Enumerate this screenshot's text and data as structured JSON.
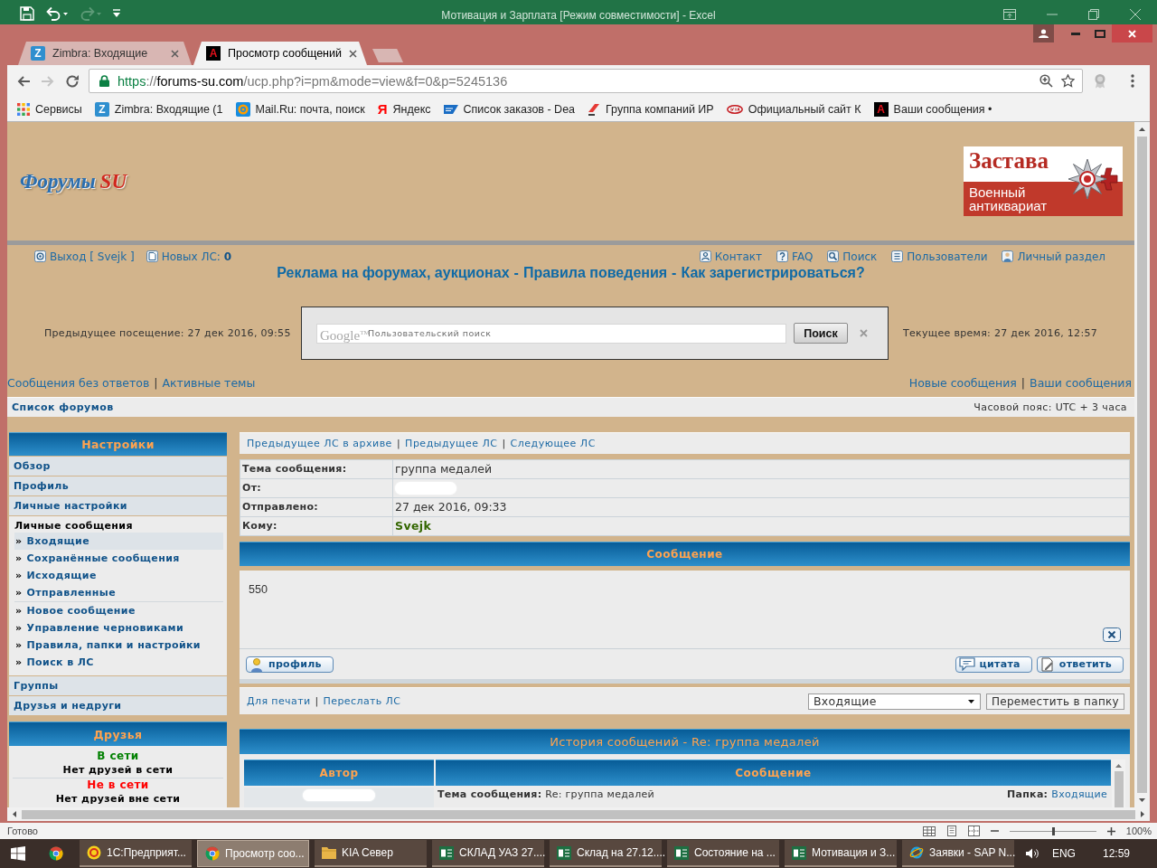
{
  "excel": {
    "title": "Мотивация и Зарплата [Режим совместимости] - Excel",
    "quick_access": [
      {
        "kind": "save",
        "disabled": false
      },
      {
        "kind": "undo",
        "disabled": false
      },
      {
        "kind": "redo",
        "disabled": true
      },
      {
        "kind": "customize",
        "disabled": false
      }
    ],
    "status": "Готово",
    "zoom": {
      "level": 0.5,
      "reading": "100%"
    }
  },
  "browser": {
    "tabs": [
      {
        "kind": "zimbra",
        "glyph": "Z",
        "label": "Zimbra: Входящие",
        "selected": false
      },
      {
        "kind": "forum",
        "glyph": "A",
        "label": "Просмотр сообщений",
        "selected": true
      }
    ],
    "nav": [
      {
        "kind": "back",
        "disabled": false
      },
      {
        "kind": "forward",
        "disabled": true
      },
      {
        "kind": "reload",
        "disabled": false
      }
    ],
    "url": {
      "scheme": "https",
      "separator": "://",
      "host": "forums-su.com",
      "path": "/ucp.php?i=pm&mode=view&f=0&p=5245136"
    },
    "bookmarks": [
      {
        "kind": "apps",
        "label": "Сервисы"
      },
      {
        "kind": "zimbra",
        "glyph": "Z",
        "label": "Zimbra: Входящие (1"
      },
      {
        "kind": "mail",
        "label": "Mail.Ru: почта, поиск"
      },
      {
        "kind": "yandex",
        "glyph": "Я",
        "label": "Яндекс"
      },
      {
        "kind": "sap",
        "label": "Список заказов - Dea"
      },
      {
        "kind": "stripe",
        "label": "Группа компаний ИР"
      },
      {
        "kind": "kia",
        "label": "Официальный сайт К"
      },
      {
        "kind": "forum",
        "glyph": "A",
        "label": "Ваши сообщения •"
      }
    ]
  },
  "forum": {
    "logo": {
      "text": "Форумы",
      "accent": "SU"
    },
    "banner": {
      "title": "Застава",
      "subtitle": "Военный антиквариат"
    },
    "user_links": [
      {
        "kind": "exit",
        "label": "Выход [ Svejk ]"
      },
      {
        "kind": "pm",
        "label": "Новых ЛС: **0**"
      }
    ],
    "nav_links": [
      {
        "kind": "contact",
        "label": "Контакт"
      },
      {
        "kind": "faq",
        "label": "FAQ"
      },
      {
        "kind": "search",
        "label": "Поиск"
      },
      {
        "kind": "users",
        "label": "Пользователи"
      },
      {
        "kind": "profile",
        "label": "Личный раздел"
      }
    ],
    "headline": {
      "links": [
        "Реклама на форумах, аукционах",
        "Правила поведения",
        "Как зарегистрироваться?"
      ],
      "separator": "-"
    },
    "last_visit": "Предыдущее посещение: 27 дек 2016, 09:55",
    "current_time": "Текущее время: 27 дек 2016, 12:57",
    "search": {
      "logo": "Google$^{TM}$",
      "placeholder": "Пользовательский поиск",
      "button": "Поиск"
    },
    "quick_links_left": {
      "links": [
        "Сообщения без ответов",
        "Активные темы"
      ],
      "separator": "|"
    },
    "quick_links_right": {
      "links": [
        "Новые сообщения",
        "Ваши сообщения"
      ],
      "separator": "|"
    },
    "breadcrumb": "Список форумов",
    "timezone": "Часовой пояс: UTC + 3 часа",
    "sidebar": {
      "title": "Настройки",
      "bullet": "»",
      "items": [
        {
          "label": "Обзор",
          "expanded": false
        },
        {
          "label": "Профиль",
          "expanded": false
        },
        {
          "label": "Личные настройки",
          "expanded": false
        },
        {
          "label": "Личные сообщения",
          "expanded": true,
          "children": [
            {
              "label": "Входящие",
              "selected": true,
              "divider": false
            },
            {
              "label": "Сохранённые сообщения",
              "selected": false,
              "divider": false
            },
            {
              "label": "Исходящие",
              "selected": false,
              "divider": false
            },
            {
              "label": "Отправленные",
              "selected": false,
              "divider": false
            },
            {
              "label": "Новое сообщение",
              "selected": false,
              "divider": true
            },
            {
              "label": "Управление черновиками",
              "selected": false,
              "divider": false
            },
            {
              "label": "Правила, папки и настройки",
              "selected": false,
              "divider": false
            },
            {
              "label": "Поиск в ЛС",
              "selected": false,
              "divider": false
            }
          ]
        },
        {
          "label": "Группы",
          "expanded": false
        },
        {
          "label": "Друзья и недруги",
          "expanded": false
        }
      ]
    },
    "friends": {
      "title": "Друзья",
      "groups": [
        {
          "kind": "online",
          "label": "В сети",
          "note": "Нет друзей в сети"
        },
        {
          "kind": "offline",
          "label": "Не в сети",
          "note": "Нет друзей вне сети"
        }
      ]
    },
    "pm_nav": {
      "links": [
        "Предыдущее ЛС в архиве",
        "Предыдущее ЛС",
        "Следующее ЛС"
      ],
      "separator": "|"
    },
    "message": {
      "fields": [
        {
          "kind": "text",
          "label": "Тема сообщения:",
          "value": "группа медалей"
        },
        {
          "kind": "redacted",
          "label": "От:"
        },
        {
          "kind": "text",
          "label": "Отправлено:",
          "value": "27 дек 2016, 09:33"
        },
        {
          "kind": "user",
          "label": "Кому:",
          "value": "Svejk"
        }
      ],
      "title": "Сообщение",
      "body": "550",
      "author_buttons": [
        {
          "kind": "profile",
          "label": "профиль"
        }
      ],
      "post_buttons": [
        {
          "kind": "quote",
          "label": "цитата"
        },
        {
          "kind": "reply",
          "label": "ответить"
        }
      ]
    },
    "actions": {
      "links": [
        "Для печати",
        "Переслать ЛС"
      ],
      "separator": "|",
      "folder": "Входящие",
      "move_button": "Переместить в папку"
    },
    "history": {
      "title": "История сообщений - Re: группа медалей",
      "columns": [
        "Автор",
        "Сообщение"
      ],
      "rows": [
        {
          "subject": "**Тема сообщения:** Re: группа медалей",
          "folder_label": "Папка:",
          "folder": "Входящие"
        }
      ]
    }
  },
  "taskbar": {
    "items": [
      {
        "kind": "onec",
        "label": "1С:Предприят...",
        "selected": false
      },
      {
        "kind": "chrome",
        "label": "Просмотр соо...",
        "selected": true
      },
      {
        "kind": "folder",
        "label": "KIA Север",
        "selected": false
      },
      {
        "kind": "excel",
        "label": "СКЛАД УАЗ 27....",
        "selected": false
      },
      {
        "kind": "excel",
        "label": "Склад на 27.12....",
        "selected": false
      },
      {
        "kind": "excel",
        "label": "Состояние на ...",
        "selected": false
      },
      {
        "kind": "excel",
        "label": "Мотивация и З...",
        "selected": false
      },
      {
        "kind": "ie",
        "label": "Заявки - SAP N...",
        "selected": false
      }
    ],
    "language": "ENG",
    "clock": "12:59"
  }
}
